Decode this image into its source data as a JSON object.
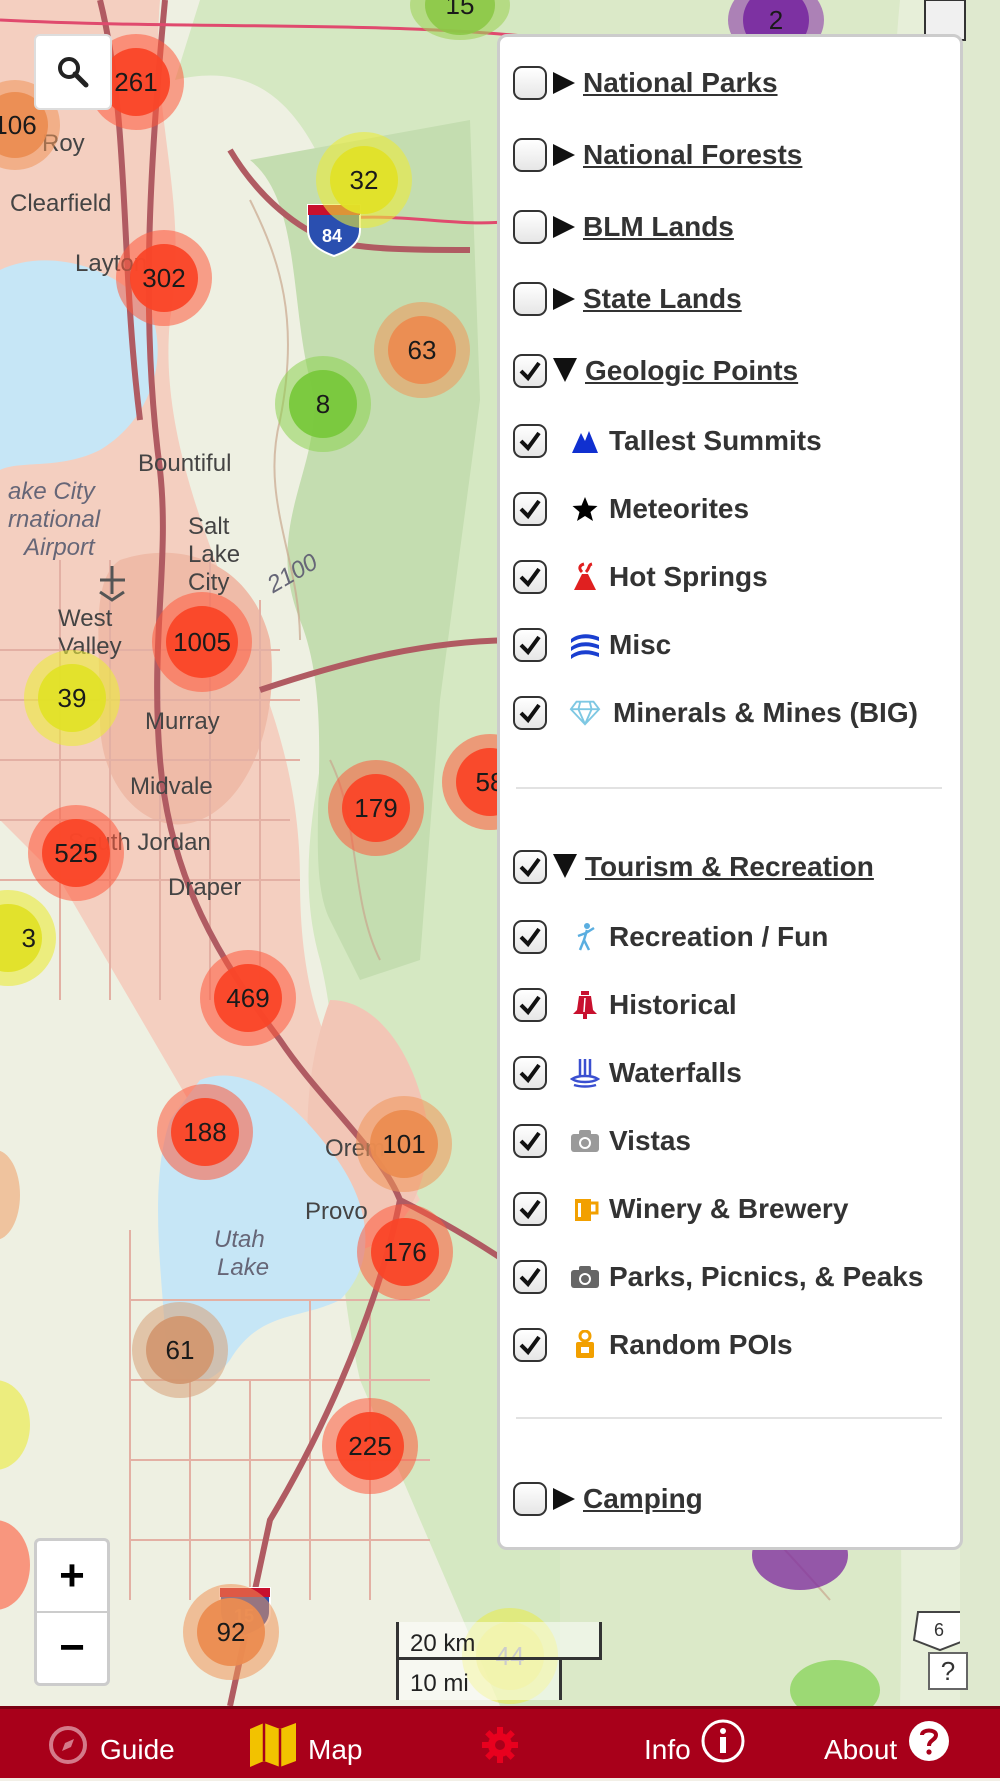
{
  "map": {
    "places": [
      {
        "name": "Roy",
        "it": false
      },
      {
        "name": "Clearfield",
        "it": false
      },
      {
        "name": "Layton",
        "it": false
      },
      {
        "name": "Bountiful",
        "it": false
      },
      {
        "name": "Salt",
        "it": false
      },
      {
        "name": "Lake",
        "it": false
      },
      {
        "name": "City",
        "it": false
      },
      {
        "name": "West",
        "it": false
      },
      {
        "name": "Valley",
        "it": false
      },
      {
        "name": "Murray",
        "it": false
      },
      {
        "name": "Midvale",
        "it": false
      },
      {
        "name": "South Jordan",
        "it": false
      },
      {
        "name": "Draper",
        "it": false
      },
      {
        "name": "Orem",
        "it": false
      },
      {
        "name": "Provo",
        "it": false
      },
      {
        "name": "ake City",
        "it": true
      },
      {
        "name": "rnational",
        "it": true
      },
      {
        "name": "Airport",
        "it": true
      },
      {
        "name": "Utah",
        "it": true
      },
      {
        "name": "Lake",
        "it": true
      },
      {
        "name": "2100",
        "it": true
      }
    ],
    "clusters": [
      "15",
      "2",
      "261",
      "106",
      "32",
      "302",
      "63",
      "8",
      "1005",
      "39",
      "179",
      "58",
      "525",
      "3",
      "469",
      "188",
      "101",
      "176",
      "61",
      "225",
      "92",
      "44"
    ],
    "highway_shields": [
      "84",
      "15",
      "6"
    ],
    "scale": {
      "km": "20 km",
      "mi": "10 mi"
    },
    "controls": {
      "zoom_in": "+",
      "zoom_out": "−",
      "help": "?"
    },
    "icons": {
      "search": "search-icon",
      "camera": "camera-icon"
    }
  },
  "layers": {
    "groups": [
      {
        "label": "National Parks",
        "checked": false,
        "expanded": false
      },
      {
        "label": "National Forests",
        "checked": false,
        "expanded": false
      },
      {
        "label": "BLM Lands",
        "checked": false,
        "expanded": false
      },
      {
        "label": "State Lands",
        "checked": false,
        "expanded": false
      },
      {
        "label": "Geologic Points",
        "checked": true,
        "expanded": true
      },
      {
        "label": "Tourism & Recreation",
        "checked": true,
        "expanded": true
      },
      {
        "label": "Camping",
        "checked": false,
        "expanded": false
      }
    ],
    "geologic": [
      {
        "label": "Tallest Summits",
        "icon": "mountain-icon",
        "color": "#1030d0"
      },
      {
        "label": "Meteorites",
        "icon": "star-icon",
        "color": "#000000"
      },
      {
        "label": "Hot Springs",
        "icon": "hot-spring-icon",
        "color": "#e02020"
      },
      {
        "label": "Misc",
        "icon": "strata-icon",
        "color": "#1a3fd0"
      },
      {
        "label": "Minerals & Mines (BIG)",
        "icon": "diamond-icon",
        "color": "#7ec8e3"
      }
    ],
    "tourism": [
      {
        "label": "Recreation / Fun",
        "icon": "person-icon",
        "color": "#5aaee0"
      },
      {
        "label": "Historical",
        "icon": "liberty-bell-icon",
        "color": "#c8102e"
      },
      {
        "label": "Waterfalls",
        "icon": "waterfall-icon",
        "color": "#3a4fd0"
      },
      {
        "label": "Vistas",
        "icon": "camera-icon",
        "color": "#9a9a9a"
      },
      {
        "label": "Winery & Brewery",
        "icon": "beer-mug-icon",
        "color": "#f2a000"
      },
      {
        "label": "Parks, Picnics, & Peaks",
        "icon": "camera-icon",
        "color": "#666666"
      },
      {
        "label": "Random POIs",
        "icon": "lock-person-icon",
        "color": "#f2a000"
      }
    ]
  },
  "tabbar": {
    "tabs": [
      {
        "label": "Guide",
        "icon": "compass-icon"
      },
      {
        "label": "Map",
        "icon": "map-icon"
      },
      {
        "label": "",
        "icon": "gear-icon"
      },
      {
        "label": "Info",
        "icon": "info-icon"
      },
      {
        "label": "About",
        "icon": "help-icon"
      }
    ],
    "colors": {
      "background": "#a8001a",
      "accent": "#f2c200"
    }
  }
}
